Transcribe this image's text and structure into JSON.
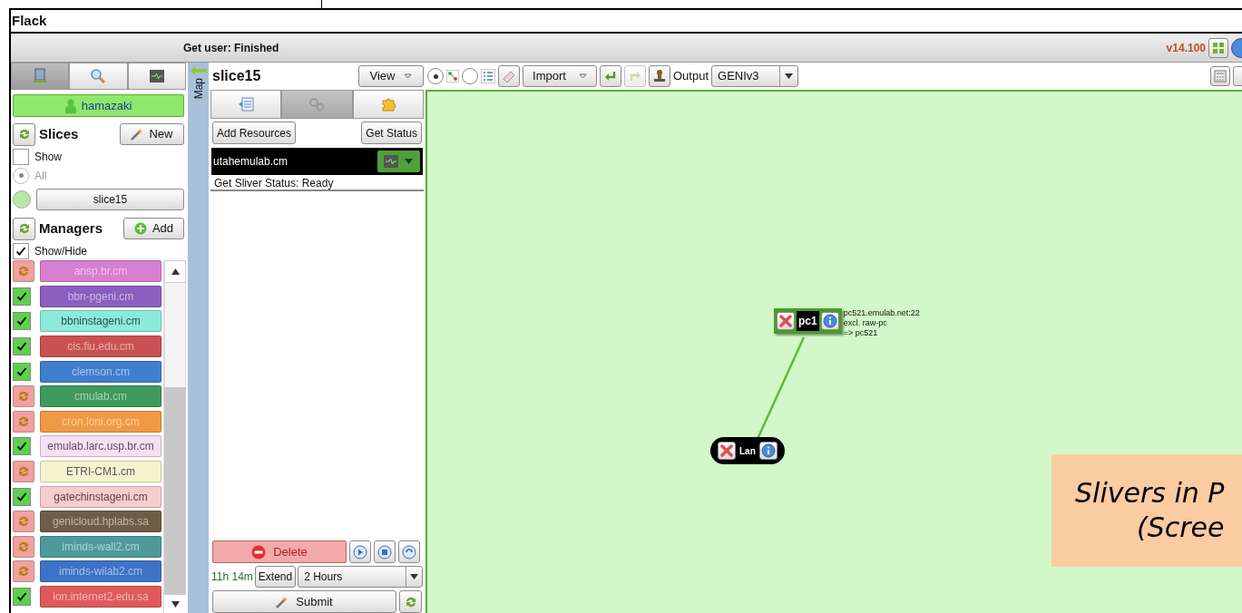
{
  "window": {
    "title": "Flack"
  },
  "status_bar": {
    "message": "Get user: Finished",
    "version": "v14.100"
  },
  "left_panel": {
    "tabs": [
      {
        "selected": true
      },
      {
        "selected": false
      },
      {
        "selected": false
      }
    ],
    "user": "hamazaki",
    "slices": {
      "title": "Slices",
      "new_button": "New",
      "show": {
        "label": "Show",
        "checked": false
      },
      "all": {
        "label": "All",
        "selected": true
      },
      "items": [
        {
          "name": "slice15"
        }
      ]
    },
    "managers": {
      "title": "Managers",
      "add_button": "Add",
      "show_hide": {
        "label": "Show/Hide",
        "checked": true
      },
      "items": [
        {
          "name": "ansp.br.cm",
          "kind": "retry",
          "color": "#d77fd0"
        },
        {
          "name": "bbn-pgeni.cm",
          "kind": "checkbox",
          "checked": true,
          "color": "#8a5fc0"
        },
        {
          "name": "bbninstageni.cm",
          "kind": "checkbox",
          "checked": true,
          "color": "#8ceadb"
        },
        {
          "name": "cis.fiu.edu.cm",
          "kind": "checkbox",
          "checked": true,
          "color": "#c85252"
        },
        {
          "name": "clemson.cm",
          "kind": "checkbox",
          "checked": true,
          "color": "#3e7fcf"
        },
        {
          "name": "cmulab.cm",
          "kind": "retry",
          "color": "#3e9a5a"
        },
        {
          "name": "cron.loni.org.cm",
          "kind": "retry",
          "color": "#f09a45"
        },
        {
          "name": "emulab.larc.usp.br.cm",
          "kind": "checkbox",
          "checked": true,
          "color": "#f7e0f2"
        },
        {
          "name": "ETRI-CM1.cm",
          "kind": "retry",
          "color": "#f4f4cf"
        },
        {
          "name": "gatechinstageni.cm",
          "kind": "checkbox",
          "checked": true,
          "color": "#f7cccc"
        },
        {
          "name": "genicloud.hplabs.sa",
          "kind": "retry",
          "color": "#6e5e48"
        },
        {
          "name": "iminds-wall2.cm",
          "kind": "retry",
          "color": "#4e9a9a"
        },
        {
          "name": "iminds-wilab2.cm",
          "kind": "retry",
          "color": "#3e72c6"
        },
        {
          "name": "ion.internet2.edu.sa",
          "kind": "checkbox",
          "checked": true,
          "color": "#e05a5a"
        }
      ]
    }
  },
  "map_strip": {
    "label": "Map"
  },
  "slice_panel": {
    "title": "slice15",
    "view_button": "View",
    "tabs": [
      {
        "selected": false
      },
      {
        "selected": true
      },
      {
        "selected": false
      }
    ],
    "add_resources": "Add Resources",
    "get_status": "Get Status",
    "slivers": [
      {
        "manager": "utahemulab.cm",
        "status": "Get Sliver Status: Ready"
      }
    ],
    "delete_button": "Delete",
    "time_left": "11h 14m",
    "extend_button": "Extend",
    "extend_duration": "2 Hours",
    "submit_button": "Submit"
  },
  "toolbar": {
    "modes": [
      {
        "selected": true
      },
      {
        "selected": false
      }
    ],
    "import_button": "Import",
    "output_label": "Output",
    "output_format": "GENIv3"
  },
  "canvas": {
    "nodes": [
      {
        "kind": "node",
        "name": "pc1",
        "info": [
          "pc521.emulab.net:22",
          "excl. raw-pc",
          "=> pc521"
        ]
      },
      {
        "kind": "lan",
        "name": "Lan"
      }
    ]
  },
  "overlay_note": {
    "lines": [
      "Slivers in P",
      "(Scree"
    ]
  }
}
